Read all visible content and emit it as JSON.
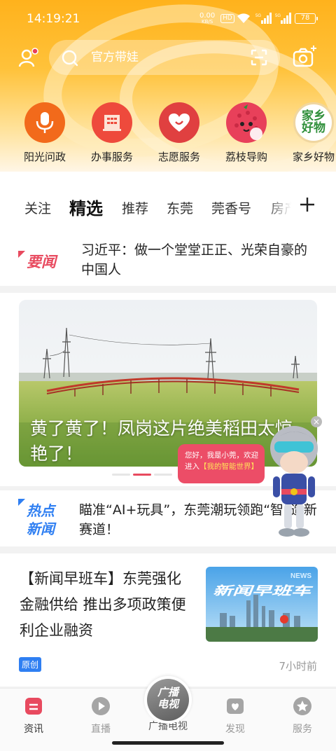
{
  "status_bar": {
    "time": "14:19:21",
    "net_speed_value": "0.00",
    "net_speed_unit": "KB/S",
    "hd_label": "HD",
    "signal1_label": "5G",
    "signal2_label": "5G",
    "battery": "78"
  },
  "search": {
    "placeholder": "官方带娃"
  },
  "quick_entries": [
    {
      "label": "阳光问政",
      "color": "#f26a1b",
      "icon": "microphone-icon"
    },
    {
      "label": "办事服务",
      "color": "#ee4a3c",
      "icon": "building-icon"
    },
    {
      "label": "志愿服务",
      "color": "#e04040",
      "icon": "heart-icon"
    },
    {
      "label": "荔枝导购",
      "color": "#e8405a",
      "icon": "lychee-icon"
    },
    {
      "label": "家乡好物",
      "color": "#2f8f3a",
      "icon": "hometown-goods-icon",
      "logo_text": "家乡好物"
    }
  ],
  "channels": [
    "关注",
    "精选",
    "推荐",
    "东莞",
    "莞香号",
    "房产"
  ],
  "active_channel": "精选",
  "headline": {
    "badge": "要闻",
    "text": "习近平：做一个堂堂正正、光荣自豪的中国人"
  },
  "carousel": {
    "caption": "黄了黄了！凤岗这片绝美稻田太惊艳了！",
    "active_index": 1,
    "dot_count": 3
  },
  "hot_news": {
    "badge_line1": "热点",
    "badge_line2": "新闻",
    "text": "瞄准“AI+玩具”，东莞潮玩领跑“智”造新赛道！"
  },
  "news_item": {
    "title": "【新闻早班车】东莞强化金融供给 推出多项政策便利企业融资",
    "thumb_text": "新闻早班车",
    "thumb_small": "NEWS",
    "badge": "原创",
    "time": "7小时前"
  },
  "assistant": {
    "line1": "您好，我是小莞，欢迎",
    "line2_prefix": "进入",
    "line2_highlight": "【我的智能世界】",
    "close": "×"
  },
  "bottom_nav": [
    {
      "label": "资讯",
      "active": true
    },
    {
      "label": "直播",
      "active": false
    },
    {
      "label": "广播电视",
      "active": false
    },
    {
      "label": "发现",
      "active": false
    },
    {
      "label": "服务",
      "active": false
    }
  ],
  "tv_button": {
    "line1": "广播",
    "line2": "电视"
  },
  "colors": {
    "brand_yellow": "#ffb21c",
    "accent_red": "#e84a5f",
    "badge_blue": "#2f7ff2"
  }
}
